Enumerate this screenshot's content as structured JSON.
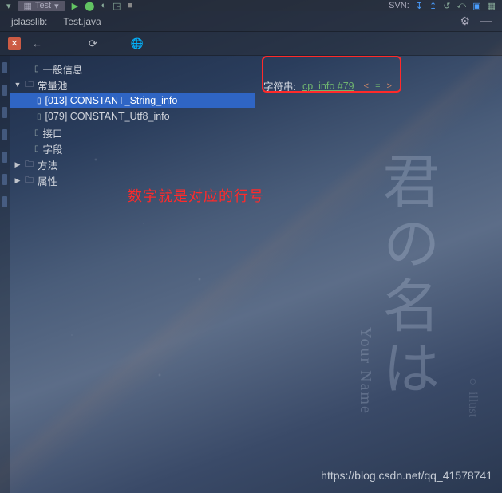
{
  "toolbar": {
    "run_config": "Test",
    "svn_label": "SVN:"
  },
  "tabs": {
    "tab1": "jclasslib:",
    "tab2": "Test.java"
  },
  "tree": {
    "n0": "一般信息",
    "n1": "常量池",
    "n1_0": "[013] CONSTANT_String_info",
    "n1_1": "[079] CONSTANT_Utf8_info",
    "n2": "接口",
    "n3": "字段",
    "n4": "方法",
    "n5": "属性"
  },
  "detail": {
    "label": "字符串:",
    "link_text": "cp_info #79",
    "op_lt": "<",
    "op_eq": "=",
    "op_gt": ">"
  },
  "annotation": "数字就是对应的行号",
  "bg": {
    "jp": "君の名は",
    "en": "Your Name",
    "illu": "○ illust"
  },
  "watermark": "https://blog.csdn.net/qq_41578741"
}
